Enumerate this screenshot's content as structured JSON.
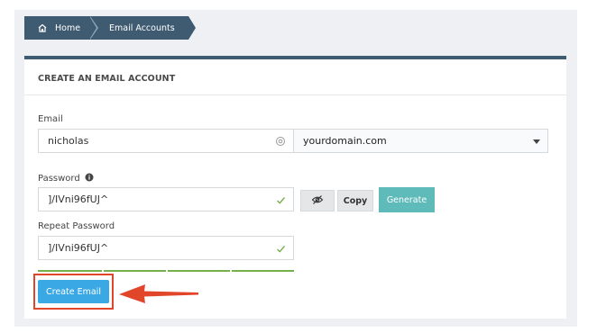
{
  "breadcrumb": {
    "home_label": "Home",
    "current_label": "Email Accounts"
  },
  "card": {
    "title": "CREATE AN EMAIL ACCOUNT"
  },
  "form": {
    "email_label": "Email",
    "email_value": "nicholas",
    "domain_value": "yourdomain.com",
    "password_label": "Password",
    "password_value": "]/IVni96fUJ^",
    "repeat_label": "Repeat Password",
    "repeat_value": "]/IVni96fUJ^",
    "copy_label": "Copy",
    "generate_label": "Generate",
    "create_label": "Create Email",
    "password_strength_fraction": 1.0
  },
  "icons": {
    "home": "home-icon",
    "email_suffix": "at-sign-icon",
    "password_info": "info-circle-icon",
    "valid": "checkmark-icon",
    "show_password": "eye-slash-icon",
    "dropdown": "caret-down-icon",
    "annotation": "red-arrow-icon"
  },
  "colors": {
    "breadcrumb": "#3f5b72",
    "accent_teal": "#5ebbb9",
    "primary_button": "#3aa8e4",
    "valid_check": "#76b04a",
    "annotation_red": "#e2462a"
  }
}
